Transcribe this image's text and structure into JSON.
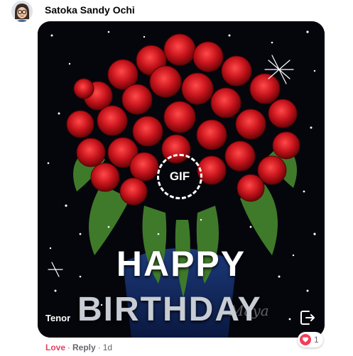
{
  "comment": {
    "author": "Satoka Sandy Ochi",
    "avatar_icon": "memoji-avatar-icon"
  },
  "gif": {
    "badge_label": "GIF",
    "headline_top": "HAPPY",
    "headline_bottom": "BIRTHDAY",
    "watermark": "Maya",
    "provider": "Tenor",
    "share_icon": "share-exit-icon",
    "background_color": "#05060c",
    "rose_color": "#c8141c"
  },
  "actions": {
    "reaction_label": "Love",
    "separator": "·",
    "reply_label": "Reply",
    "time": "1d"
  },
  "reaction_badge": {
    "icon": "heart-icon",
    "count": "1",
    "color": "#f33e58"
  }
}
